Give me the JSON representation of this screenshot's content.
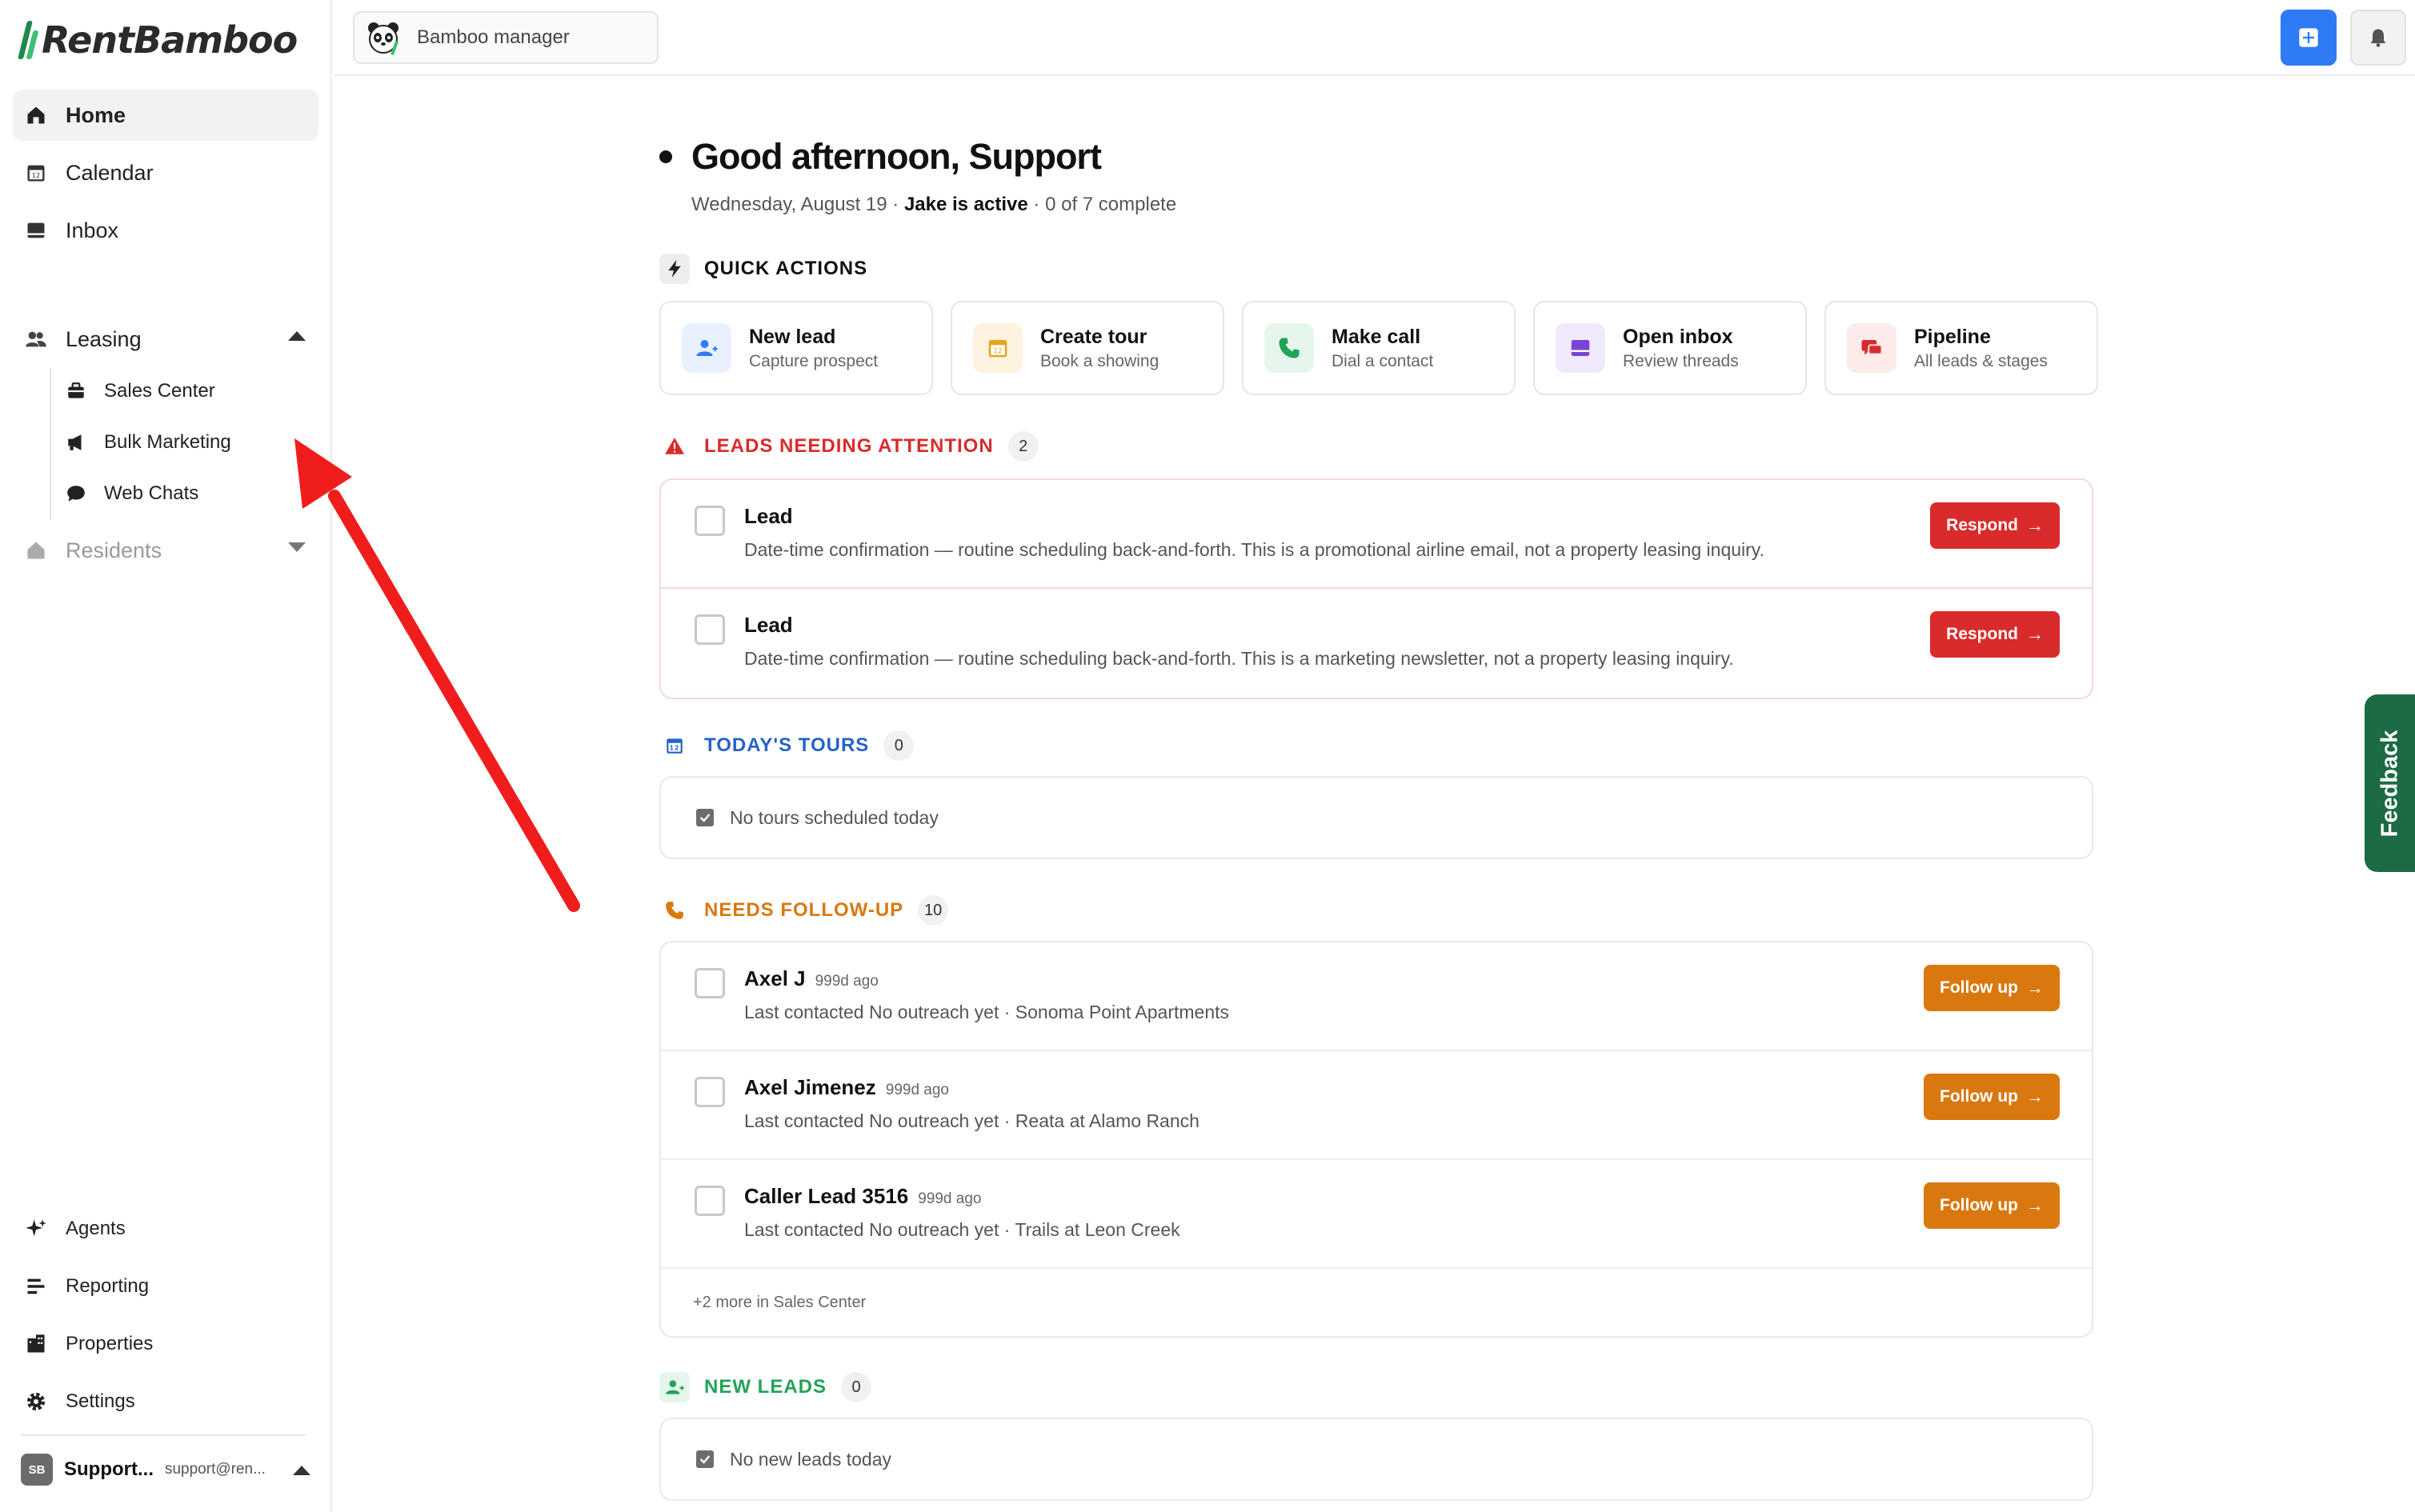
{
  "brand": {
    "name": "RentBamboo",
    "accent": "#1f8a4c"
  },
  "sidebar": {
    "primary": [
      {
        "label": "Home",
        "icon": "home-icon",
        "active": true
      },
      {
        "label": "Calendar",
        "icon": "calendar-icon"
      },
      {
        "label": "Inbox",
        "icon": "inbox-icon"
      }
    ],
    "leasing": {
      "label": "Leasing",
      "expanded": true,
      "items": [
        {
          "label": "Sales Center",
          "icon": "briefcase-icon"
        },
        {
          "label": "Bulk Marketing",
          "icon": "megaphone-icon"
        },
        {
          "label": "Web Chats",
          "icon": "chat-bubble-icon"
        }
      ]
    },
    "residents": {
      "label": "Residents",
      "expanded": false
    },
    "bottom": [
      {
        "label": "Agents",
        "icon": "sparkle-icon"
      },
      {
        "label": "Reporting",
        "icon": "bars-icon"
      },
      {
        "label": "Properties",
        "icon": "building-icon"
      },
      {
        "label": "Settings",
        "icon": "gear-icon"
      }
    ],
    "user": {
      "initials": "SB",
      "name": "Support...",
      "email": "support@ren..."
    }
  },
  "topbar": {
    "account_switcher": "Bamboo manager"
  },
  "greeting": {
    "title": "Good afternoon, Support",
    "date": "Wednesday, August 19",
    "active": "Jake is active",
    "progress": "0 of 7 complete"
  },
  "quick_actions": {
    "title": "QUICK ACTIONS",
    "items": [
      {
        "title": "New lead",
        "sub": "Capture prospect",
        "icon": "add-person-icon",
        "color": "#2f7bf5"
      },
      {
        "title": "Create tour",
        "sub": "Book a showing",
        "icon": "calendar-icon",
        "color": "#e8a21a"
      },
      {
        "title": "Make call",
        "sub": "Dial a contact",
        "icon": "phone-icon",
        "color": "#22a35a"
      },
      {
        "title": "Open inbox",
        "sub": "Review threads",
        "icon": "inbox-icon",
        "color": "#7b43d6"
      },
      {
        "title": "Pipeline",
        "sub": "All leads & stages",
        "icon": "chat-icon",
        "color": "#d92b2b"
      }
    ]
  },
  "leads_attention": {
    "title": "LEADS NEEDING ATTENTION",
    "count": "2",
    "color": "#d92b2b",
    "rows": [
      {
        "name": "Lead",
        "desc": "Date-time confirmation — routine scheduling back-and-forth. This is a promotional airline email, not a property leasing inquiry.",
        "action": "Respond"
      },
      {
        "name": "Lead",
        "desc": "Date-time confirmation — routine scheduling back-and-forth. This is a marketing newsletter, not a property leasing inquiry.",
        "action": "Respond"
      }
    ]
  },
  "todays_tours": {
    "title": "TODAY'S TOURS",
    "count": "0",
    "color": "#2563c9",
    "empty": "No tours scheduled today"
  },
  "follow_up": {
    "title": "NEEDS FOLLOW-UP",
    "count": "10",
    "color": "#d9780f",
    "rows": [
      {
        "name": "Axel J",
        "ago": "999d ago",
        "desc": "Last contacted No outreach yet · Sonoma Point Apartments",
        "action": "Follow up"
      },
      {
        "name": "Axel Jimenez",
        "ago": "999d ago",
        "desc": "Last contacted No outreach yet · Reata at Alamo Ranch",
        "action": "Follow up"
      },
      {
        "name": "Caller Lead 3516",
        "ago": "999d ago",
        "desc": "Last contacted No outreach yet · Trails at Leon Creek",
        "action": "Follow up"
      }
    ],
    "more": "+2 more in Sales Center"
  },
  "new_leads": {
    "title": "NEW LEADS",
    "count": "0",
    "color": "#22a35a",
    "empty": "No new leads today"
  },
  "feedback": {
    "label": "Feedback",
    "color": "#1c6b45"
  }
}
